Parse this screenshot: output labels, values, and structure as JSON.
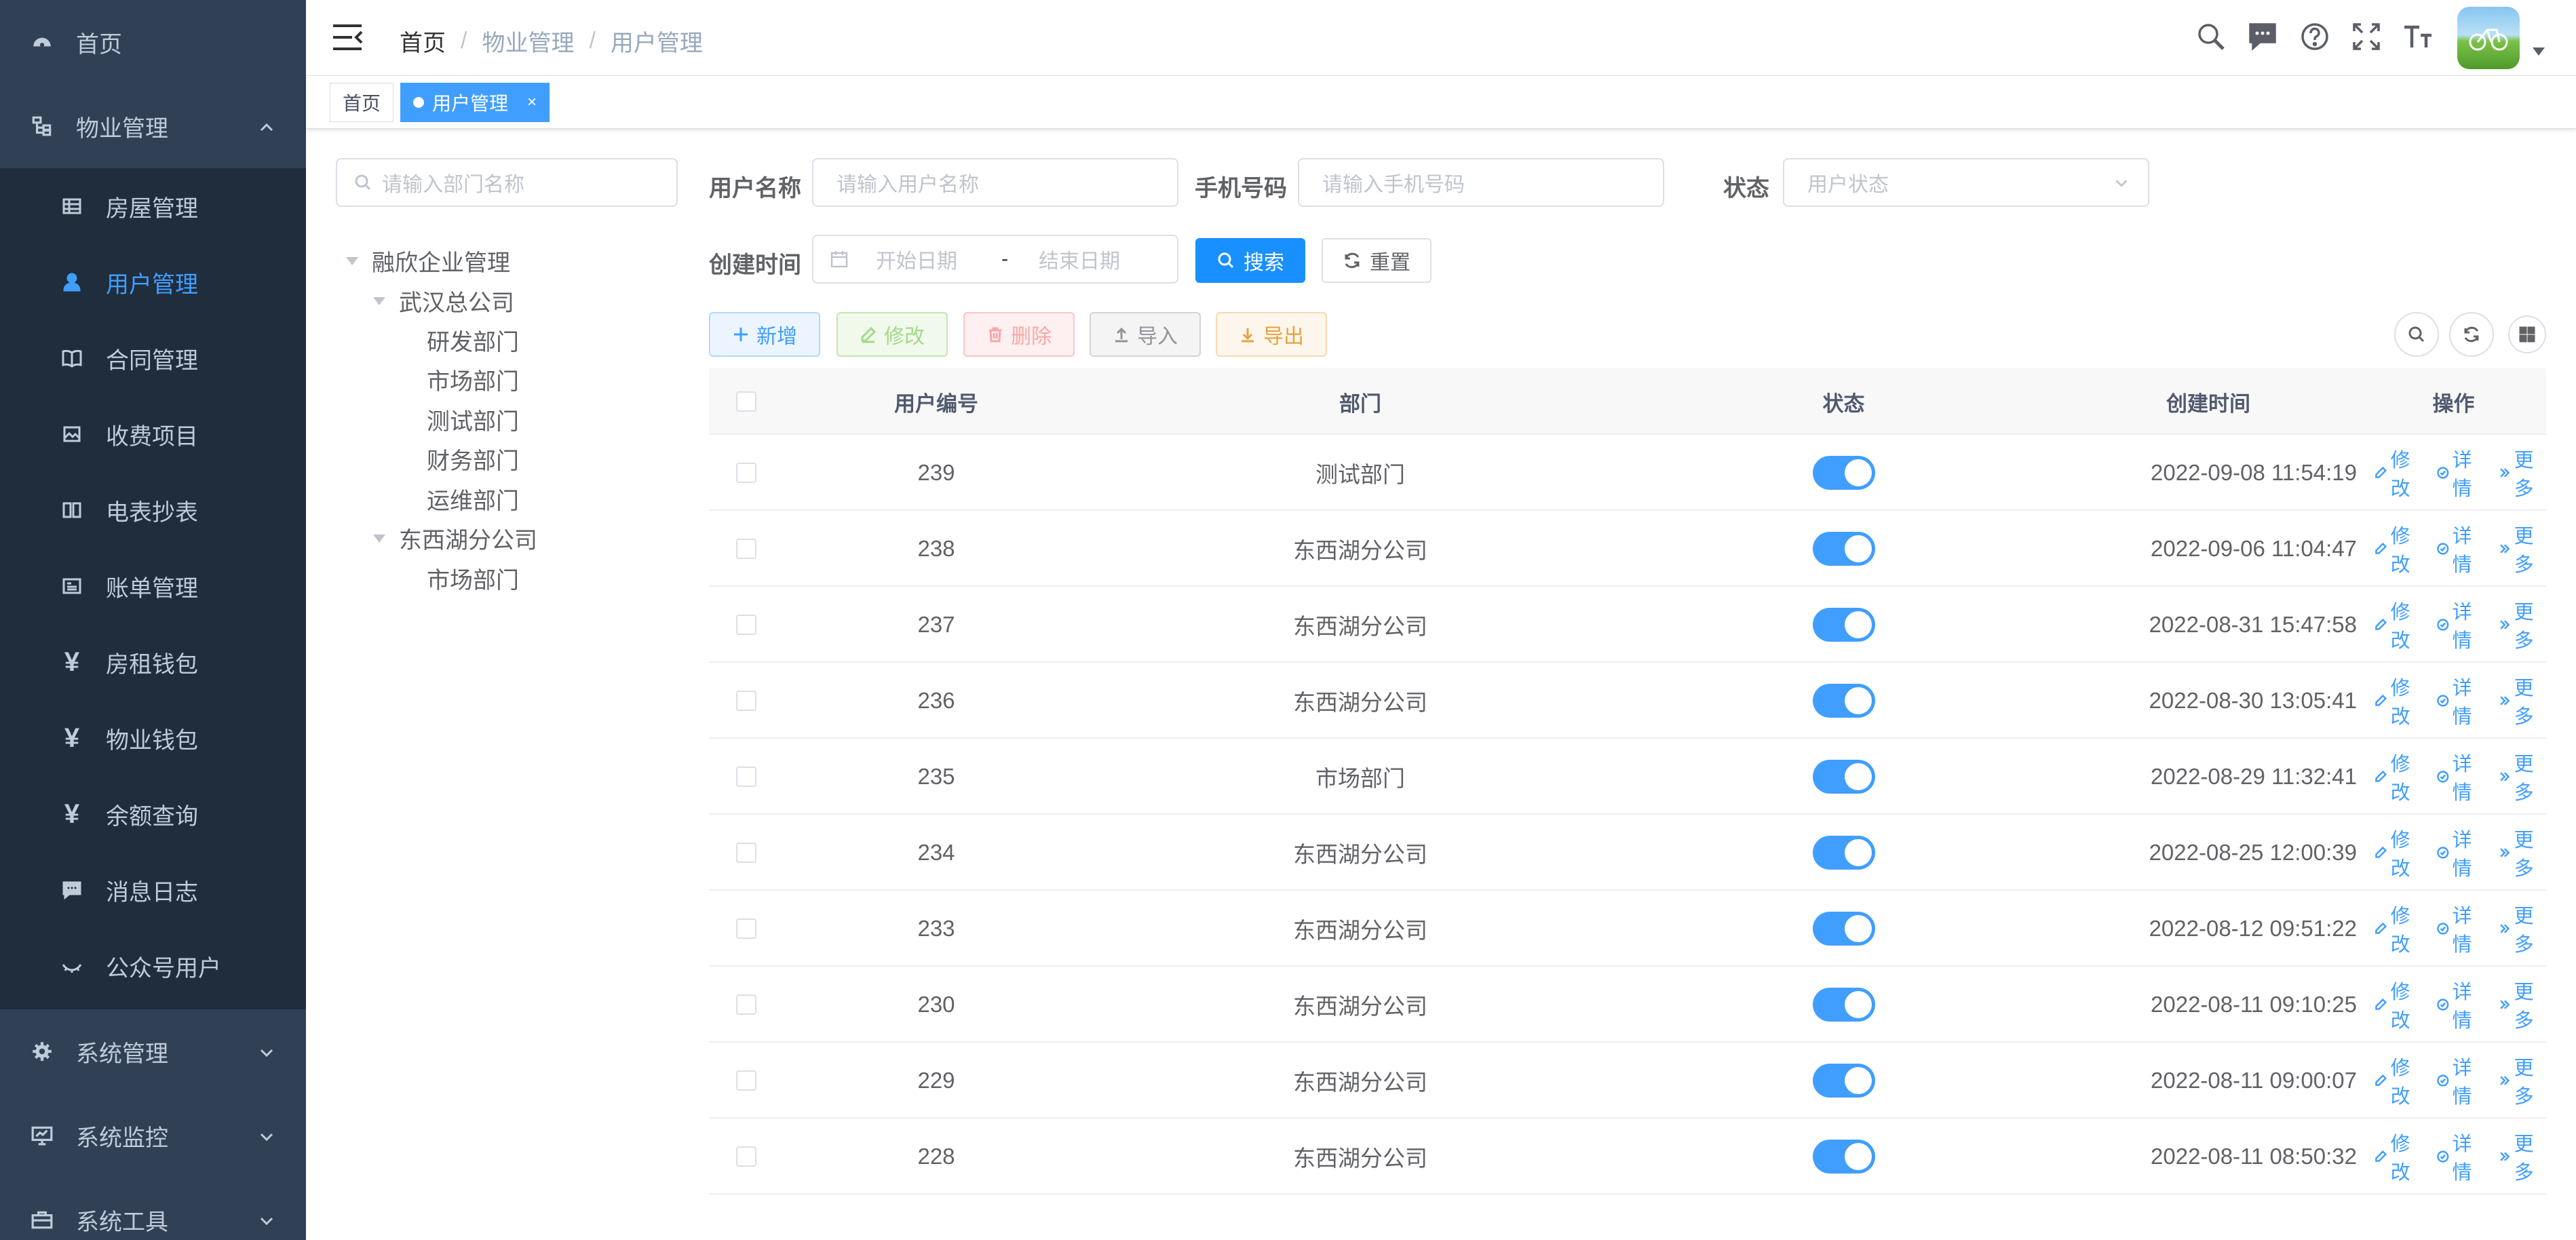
{
  "sidebar": {
    "home": "首页",
    "property": "物业管理",
    "sub_items": [
      {
        "label": "房屋管理",
        "icon": "table-icon"
      },
      {
        "label": "用户管理",
        "icon": "user-icon"
      },
      {
        "label": "合同管理",
        "icon": "book-icon"
      },
      {
        "label": "收费项目",
        "icon": "picture-icon"
      },
      {
        "label": "电表抄表",
        "icon": "meter-book-icon"
      },
      {
        "label": "账单管理",
        "icon": "bill-icon"
      },
      {
        "label": "房租钱包",
        "icon": "yen-icon"
      },
      {
        "label": "物业钱包",
        "icon": "yen-icon"
      },
      {
        "label": "余额查询",
        "icon": "yen-icon"
      },
      {
        "label": "消息日志",
        "icon": "message-icon"
      },
      {
        "label": "公众号用户",
        "icon": "eye-icon"
      }
    ],
    "system": "系统管理",
    "monitor": "系统监控",
    "tools": "系统工具",
    "yen_glyph": "¥"
  },
  "navbar": {
    "breadcrumb": [
      "首页",
      "物业管理",
      "用户管理"
    ],
    "separator": "/"
  },
  "tags": {
    "home": "首页",
    "active": "用户管理",
    "close_glyph": "×"
  },
  "dept": {
    "search_placeholder": "请输入部门名称",
    "tree": {
      "root": "融欣企业管理",
      "wuhan": "武汉总公司",
      "wuhan_children": [
        "研发部门",
        "市场部门",
        "测试部门",
        "财务部门",
        "运维部门"
      ],
      "dongxihu": "东西湖分公司",
      "dongxihu_children": [
        "市场部门"
      ]
    }
  },
  "form": {
    "username_label": "用户名称",
    "username_placeholder": "请输入用户名称",
    "phone_label": "手机号码",
    "phone_placeholder": "请输入手机号码",
    "status_label": "状态",
    "status_placeholder": "用户状态",
    "created_label": "创建时间",
    "start_placeholder": "开始日期",
    "date_sep": "-",
    "end_placeholder": "结束日期",
    "search_btn": "搜索",
    "reset_btn": "重置"
  },
  "toolbar": {
    "add": "新增",
    "edit": "修改",
    "delete": "删除",
    "import": "导入",
    "export": "导出"
  },
  "table": {
    "headers": {
      "id": "用户编号",
      "dept": "部门",
      "status": "状态",
      "created": "创建时间",
      "ops": "操作"
    },
    "op_labels": {
      "edit": "修改",
      "detail": "详情",
      "more": "更多"
    },
    "rows": [
      {
        "id": "239",
        "dept": "测试部门",
        "created": "2022-09-08 11:54:19",
        "enabled": true
      },
      {
        "id": "238",
        "dept": "东西湖分公司",
        "created": "2022-09-06 11:04:47",
        "enabled": true
      },
      {
        "id": "237",
        "dept": "东西湖分公司",
        "created": "2022-08-31 15:47:58",
        "enabled": true
      },
      {
        "id": "236",
        "dept": "东西湖分公司",
        "created": "2022-08-30 13:05:41",
        "enabled": true
      },
      {
        "id": "235",
        "dept": "市场部门",
        "created": "2022-08-29 11:32:41",
        "enabled": true
      },
      {
        "id": "234",
        "dept": "东西湖分公司",
        "created": "2022-08-25 12:00:39",
        "enabled": true
      },
      {
        "id": "233",
        "dept": "东西湖分公司",
        "created": "2022-08-12 09:51:22",
        "enabled": true
      },
      {
        "id": "230",
        "dept": "东西湖分公司",
        "created": "2022-08-11 09:10:25",
        "enabled": true
      },
      {
        "id": "229",
        "dept": "东西湖分公司",
        "created": "2022-08-11 09:00:07",
        "enabled": true
      },
      {
        "id": "228",
        "dept": "东西湖分公司",
        "created": "2022-08-11 08:50:32",
        "enabled": true
      }
    ]
  },
  "colors": {
    "sidebar_bg": "#304156",
    "submenu_bg": "#1f2d3d",
    "primary": "#409eff",
    "sidebar_text": "#bfcbd9"
  }
}
